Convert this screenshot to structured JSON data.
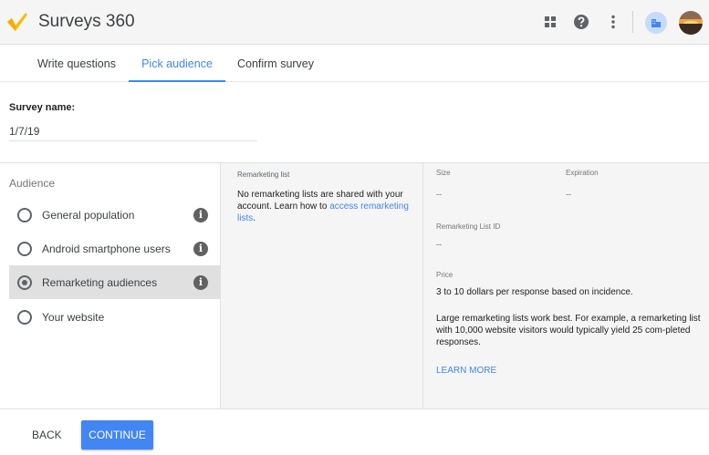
{
  "app": {
    "title": "Surveys 360"
  },
  "header": {
    "icons": [
      "apps-grid-icon",
      "help-icon",
      "more-vert-icon"
    ],
    "account_icon": "business-icon"
  },
  "tabs": [
    {
      "label": "Write questions",
      "active": false
    },
    {
      "label": "Pick audience",
      "active": true
    },
    {
      "label": "Confirm survey",
      "active": false
    }
  ],
  "survey": {
    "name_label": "Survey name:",
    "name_value": "1/7/19"
  },
  "audience": {
    "heading": "Audience",
    "options": [
      {
        "label": "General population",
        "selected": false,
        "info": true
      },
      {
        "label": "Android smartphone users",
        "selected": false,
        "info": true
      },
      {
        "label": "Remarketing audiences",
        "selected": true,
        "info": true
      },
      {
        "label": "Your website",
        "selected": false,
        "info": false
      }
    ]
  },
  "remarketing": {
    "heading": "Remarketing list",
    "message": "No remarketing lists are shared with your account. Learn how to ",
    "link": "access remarketing lists",
    "message_end": "."
  },
  "details": {
    "size_label": "Size",
    "size_value": "--",
    "expiration_label": "Expiration",
    "expiration_value": "--",
    "list_id_label": "Remarketing List ID",
    "list_id_value": "--",
    "price_label": "Price",
    "price_value": "3 to 10 dollars per response based on incidence.",
    "note": "Large remarketing lists work best. For example, a remarketing list with 10,000 website visitors would typically yield 25 com-pleted responses.",
    "learn_more": "LEARN MORE"
  },
  "footer": {
    "back_label": "BACK",
    "continue_label": "CONTINUE"
  },
  "colors": {
    "accent": "#4285f4",
    "logo": "#fbbc04",
    "selected_bg": "#e0e0e0"
  }
}
